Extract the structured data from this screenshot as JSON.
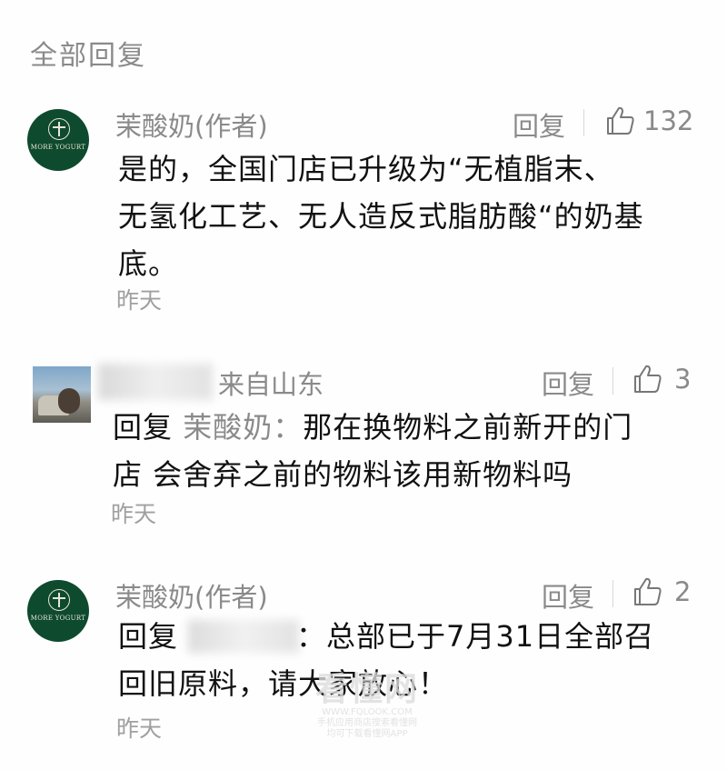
{
  "section": {
    "title": "全部回复"
  },
  "comments": [
    {
      "author": "茉酸奶(作者)",
      "avatar_text": "MORE YOGURT",
      "reply_label": "回复",
      "likes": "132",
      "lines": [
        "是的，全国门店已升级为“无植脂末、",
        "无氢化工艺、无人造反式脂肪酸“的奶基",
        "底。"
      ],
      "time": "昨天"
    },
    {
      "author_blurred": true,
      "location": "来自山东",
      "reply_label": "回复",
      "likes": "3",
      "reply_prefix": "回复",
      "reply_target": "茉酸奶：",
      "lines": [
        "那在换物料之前新开的门",
        "店 会舍弃之前的物料该用新物料吗"
      ],
      "time": "昨天"
    },
    {
      "author": "茉酸奶(作者)",
      "avatar_text": "MORE YOGURT",
      "reply_label": "回复",
      "likes": "2",
      "reply_prefix": "回复",
      "lines": [
        "：总部已于7月31日全部召",
        "回旧原料，请大家放心！"
      ],
      "time": "昨天"
    }
  ],
  "watermark": {
    "title": "看懂网",
    "line1": "WWW.FQLOOK.COM",
    "line2": "手机应用商店搜索看懂网",
    "line3": "均可下载看懂网APP"
  },
  "colors": {
    "avatar_green": "#0e4a2e",
    "muted": "#8a8a8a",
    "text": "#111111"
  }
}
